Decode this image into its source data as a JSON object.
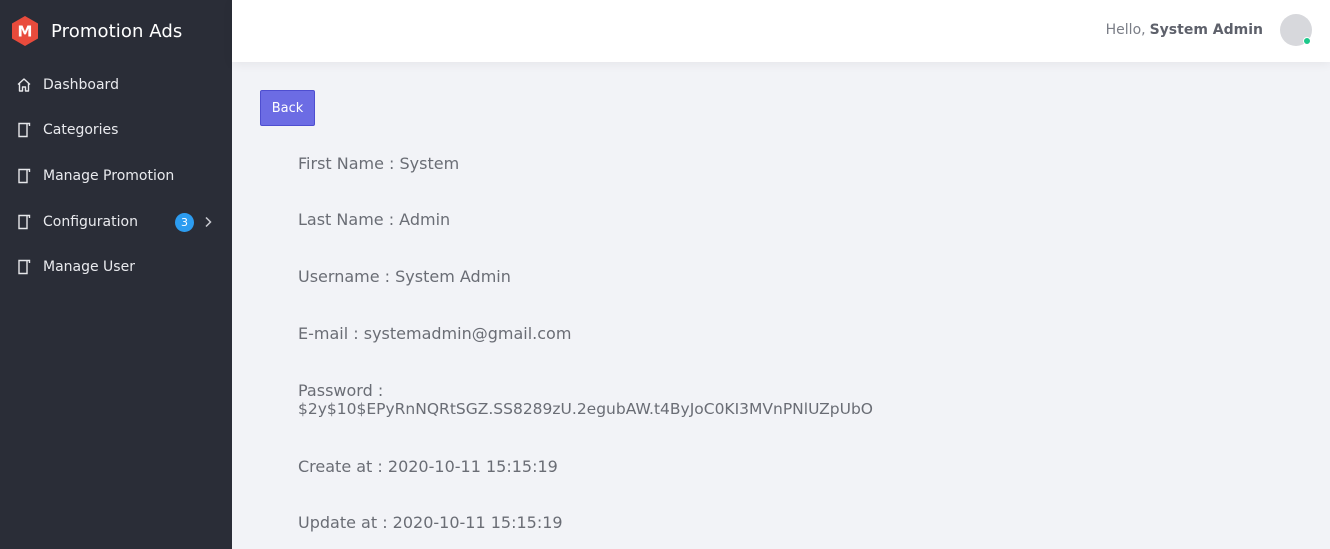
{
  "brand": {
    "name": "Promotion Ads",
    "logo_letter": "M",
    "logo_color": "#e94b3c"
  },
  "sidebar": {
    "items": [
      {
        "label": "Dashboard",
        "icon": "home-icon"
      },
      {
        "label": "Categories",
        "icon": "page-icon"
      },
      {
        "label": "Manage Promotion",
        "icon": "page-icon"
      },
      {
        "label": "Configuration",
        "icon": "page-icon",
        "badge": "3"
      },
      {
        "label": "Manage User",
        "icon": "page-icon"
      }
    ]
  },
  "header": {
    "greeting": "Hello,",
    "user_name": "System Admin",
    "status_color": "#1cc88a"
  },
  "main": {
    "back_label": "Back",
    "first_name": "First Name : System",
    "last_name": "Last Name : Admin",
    "username": "Username : System Admin",
    "email": "E-mail : systemadmin@gmail.com",
    "password_label": "Password :",
    "password_value": "$2y$10$EPyRnNQRtSGZ.SS8289zU.2egubAW.t4ByJoC0KI3MVnPNlUZpUbO",
    "created": "Create at : 2020-10-11 15:15:19",
    "updated": "Update at : 2020-10-11 15:15:19"
  }
}
